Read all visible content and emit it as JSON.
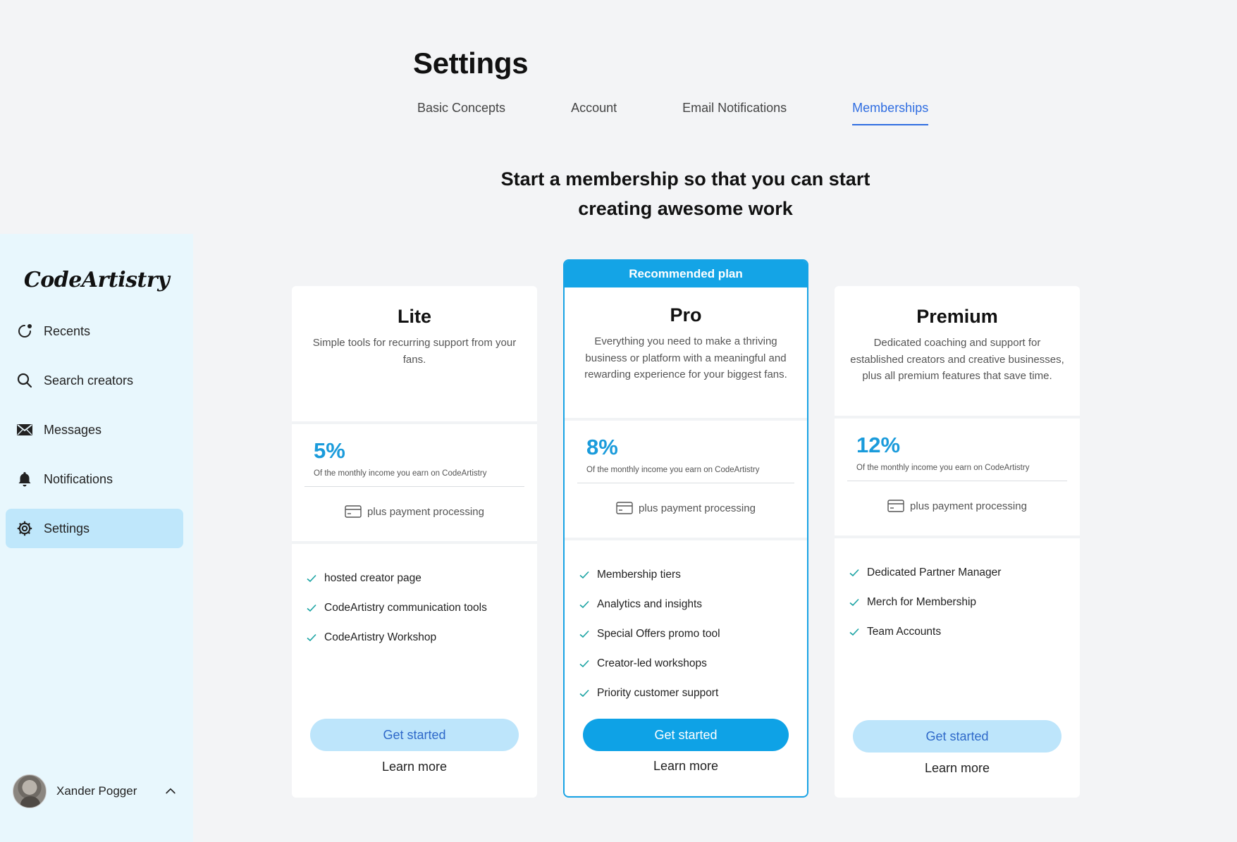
{
  "app": {
    "logo": "CodeArtistry"
  },
  "sidebar": {
    "items": [
      {
        "label": "Recents",
        "icon": "recents-icon"
      },
      {
        "label": "Search creators",
        "icon": "search-icon"
      },
      {
        "label": "Messages",
        "icon": "mail-icon"
      },
      {
        "label": "Notifications",
        "icon": "bell-icon"
      },
      {
        "label": "Settings",
        "icon": "gear-icon",
        "active": true
      }
    ],
    "user": {
      "name": "Xander Pogger"
    }
  },
  "header": {
    "title": "Settings",
    "tabs": [
      {
        "label": "Basic Concepts"
      },
      {
        "label": "Account"
      },
      {
        "label": "Email Notifications"
      },
      {
        "label": "Memberships",
        "active": true
      }
    ]
  },
  "main": {
    "headline_line1": "Start a membership so that you can start",
    "headline_line2": "creating awesome work",
    "plans": [
      {
        "name": "Lite",
        "description": "Simple tools for recurring support from your fans.",
        "percent": "5%",
        "percent_note": "Of the monthly income you earn on CodeArtistry",
        "processing": "plus payment processing",
        "features": [
          "hosted creator page",
          "CodeArtistry communication tools",
          "CodeArtistry Workshop"
        ],
        "cta": "Get started",
        "learn_more": "Learn more"
      },
      {
        "banner": "Recommended plan",
        "name": "Pro",
        "description": "Everything you need to make a thriving business or platform with a meaningful and rewarding experience for your biggest fans.",
        "percent": "8%",
        "percent_note": "Of the monthly income you earn on CodeArtistry",
        "processing": "plus payment processing",
        "features": [
          "Membership tiers",
          "Analytics and insights",
          "Special Offers promo tool",
          "Creator-led workshops",
          "Priority customer support"
        ],
        "cta": "Get started",
        "learn_more": "Learn more"
      },
      {
        "name": "Premium",
        "description": "Dedicated coaching and support for established creators and creative businesses, plus all premium features that save time.",
        "percent": "12%",
        "percent_note": "Of the monthly income you earn on CodeArtistry",
        "processing": "plus payment processing",
        "features": [
          "Dedicated Partner Manager",
          "Merch for Membership",
          "Team Accounts"
        ],
        "cta": "Get started",
        "learn_more": "Learn more"
      }
    ]
  },
  "colors": {
    "accent": "#17a3e5",
    "tab_active": "#2f6de1",
    "sidebar_bg": "#e8f7fd",
    "nav_active_bg": "#bfe7fb",
    "button_light": "#bde5fb",
    "percent": "#1a9bdb"
  }
}
